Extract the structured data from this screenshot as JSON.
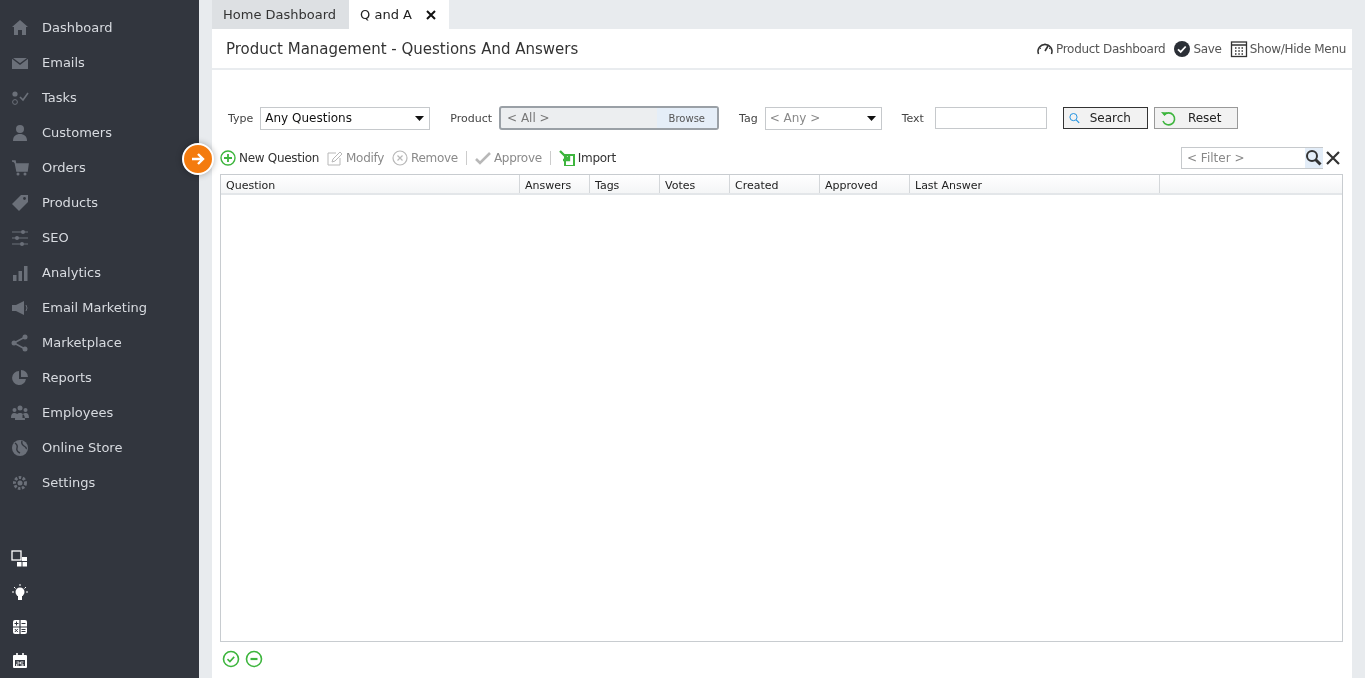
{
  "sidebar": {
    "items": [
      {
        "label": "Dashboard"
      },
      {
        "label": "Emails"
      },
      {
        "label": "Tasks"
      },
      {
        "label": "Customers"
      },
      {
        "label": "Orders"
      },
      {
        "label": "Products"
      },
      {
        "label": "SEO"
      },
      {
        "label": "Analytics"
      },
      {
        "label": "Email Marketing"
      },
      {
        "label": "Marketplace"
      },
      {
        "label": "Reports"
      },
      {
        "label": "Employees"
      },
      {
        "label": "Online Store"
      },
      {
        "label": "Settings"
      }
    ]
  },
  "tabs": [
    {
      "label": "Home Dashboard",
      "selected": false,
      "closable": false
    },
    {
      "label": "Q and A",
      "selected": true,
      "closable": true
    }
  ],
  "page": {
    "title": "Product Management - Questions And Answers",
    "actions": [
      "Product Dashboard",
      "Save",
      "Show/Hide Menu"
    ]
  },
  "filters": {
    "type": {
      "label": "Type",
      "value": "Any Questions"
    },
    "product": {
      "label": "Product",
      "placeholder": "< All >",
      "browse": "Browse"
    },
    "tag": {
      "label": "Tag",
      "placeholder": "< Any >"
    },
    "text": {
      "label": "Text"
    },
    "search": "Search",
    "reset": "Reset"
  },
  "toolbar": [
    {
      "label": "New Question",
      "disabled": false
    },
    {
      "label": "Modify",
      "disabled": true
    },
    {
      "label": "Remove",
      "disabled": true
    },
    {
      "label": "Approve",
      "disabled": true
    },
    {
      "label": "Import",
      "disabled": false
    }
  ],
  "grid_filter": {
    "placeholder": "< Filter >"
  },
  "table": {
    "columns": [
      "Question",
      "Answers",
      "Tags",
      "Votes",
      "Created",
      "Approved",
      "Last Answer"
    ]
  }
}
